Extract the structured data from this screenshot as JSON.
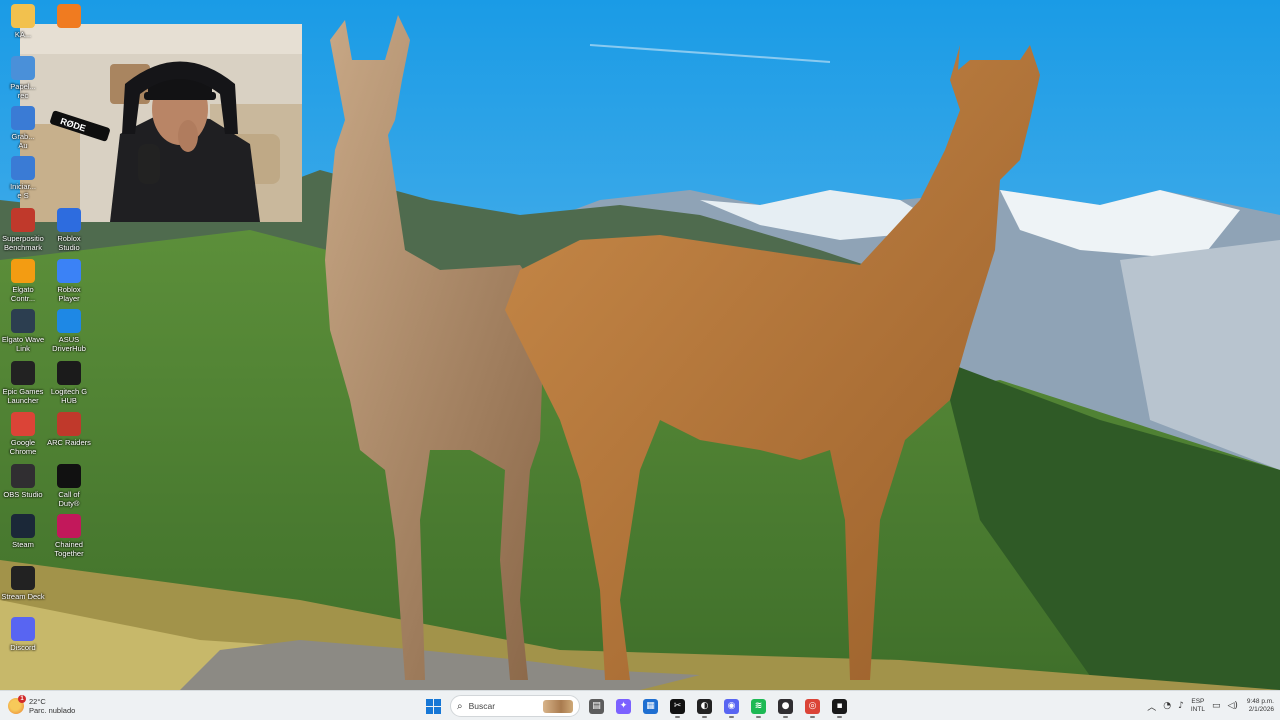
{
  "desktop": {
    "icons": [
      {
        "label": "KA...",
        "icon": "folder-icon",
        "color": "#f2c14e"
      },
      {
        "label": "",
        "icon": "app-orange-icon",
        "color": "#f07b20"
      },
      {
        "label": "Papel...\nrec",
        "icon": "recycle-bin-icon",
        "color": "#4a90d9"
      },
      {
        "label": "Grab...\nAu",
        "icon": "recorder-icon",
        "color": "#3a7bd5"
      },
      {
        "label": "Iniciar...\ne S",
        "icon": "launcher-icon",
        "color": "#3a7bd5"
      },
      {
        "label": "Superpositio\nBenchmark",
        "icon": "benchmark-icon",
        "color": "#c0392b"
      },
      {
        "label": "Roblox\nStudio",
        "icon": "roblox-studio-icon",
        "color": "#2d6cdf"
      },
      {
        "label": "Elgato\nContr...",
        "icon": "elgato-control-icon",
        "color": "#f39c12"
      },
      {
        "label": "Roblox\nPlayer",
        "icon": "roblox-player-icon",
        "color": "#3b82f6"
      },
      {
        "label": "Elgato Wave\nLink",
        "icon": "elgato-wave-link-icon",
        "color": "#2c3e50"
      },
      {
        "label": "ASUS\nDriverHub",
        "icon": "asus-driverhub-icon",
        "color": "#1e88e5"
      },
      {
        "label": "Epic Games\nLauncher",
        "icon": "epic-games-icon",
        "color": "#222222"
      },
      {
        "label": "Logitech G\nHUB",
        "icon": "logitech-ghub-icon",
        "color": "#1b1b1b"
      },
      {
        "label": "Google\nChrome",
        "icon": "chrome-icon",
        "color": "#db4437"
      },
      {
        "label": "ARC Raiders",
        "icon": "arc-raiders-icon",
        "color": "#c0392b"
      },
      {
        "label": "OBS Studio",
        "icon": "obs-studio-icon",
        "color": "#302e31"
      },
      {
        "label": "Call of\nDuty®",
        "icon": "call-of-duty-icon",
        "color": "#111111"
      },
      {
        "label": "Steam",
        "icon": "steam-icon",
        "color": "#1b2838"
      },
      {
        "label": "Chained\nTogether",
        "icon": "chained-together-icon",
        "color": "#c2185b"
      },
      {
        "label": "Stream Deck",
        "icon": "stream-deck-icon",
        "color": "#222222"
      },
      {
        "label": "Discord",
        "icon": "discord-icon",
        "color": "#5865f2"
      }
    ]
  },
  "webcam": {
    "mic_brand": "RØDE"
  },
  "taskbar": {
    "weather": {
      "temp": "22°C",
      "desc": "Parc. nublado",
      "badge": "1"
    },
    "search_placeholder": "Buscar",
    "apps": [
      {
        "icon": "file-explorer-taskbar-icon",
        "color": "#5c5c5c",
        "glyph": "▤"
      },
      {
        "icon": "copilot-taskbar-icon",
        "color": "#7b61ff",
        "glyph": "✦"
      },
      {
        "icon": "store-taskbar-icon",
        "color": "#1f6fd1",
        "glyph": "▦"
      },
      {
        "icon": "capcut-taskbar-icon",
        "color": "#111111",
        "glyph": "✂"
      },
      {
        "icon": "app-dark-taskbar-icon",
        "color": "#222222",
        "glyph": "◐"
      },
      {
        "icon": "discord-taskbar-icon",
        "color": "#5865f2",
        "glyph": "◉"
      },
      {
        "icon": "spotify-taskbar-icon",
        "color": "#1db954",
        "glyph": "≋"
      },
      {
        "icon": "obs-taskbar-icon",
        "color": "#302e31",
        "glyph": "●"
      },
      {
        "icon": "chrome-taskbar-icon",
        "color": "#db4437",
        "glyph": "◎"
      },
      {
        "icon": "stream-deck-taskbar-icon",
        "color": "#1a1a1a",
        "glyph": "▪"
      }
    ],
    "language": {
      "line1": "ESP",
      "line2": "INTL"
    },
    "clock": {
      "time": "9:48 p.m.",
      "date": "2/1/2026"
    }
  }
}
